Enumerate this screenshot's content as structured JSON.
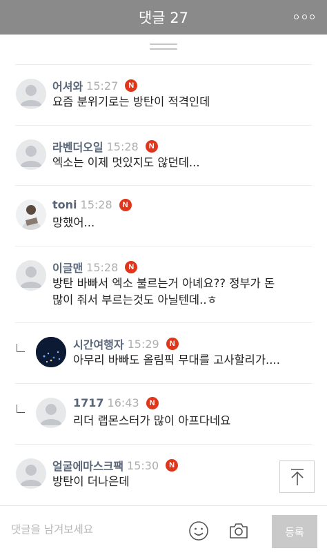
{
  "header": {
    "title": "댓글 27",
    "more_icon": "more-icon"
  },
  "comments": [
    {
      "author": "어셔와",
      "time": "15:27",
      "badge": "N",
      "lines": [
        "요즘 분위기로는 방탄이 적격인데"
      ],
      "avatar": "default"
    },
    {
      "author": "라벤더오일",
      "time": "15:28",
      "badge": "N",
      "lines": [
        "엑소는 이제 멋있지도 않던데..."
      ],
      "avatar": "default"
    },
    {
      "author": "toni",
      "time": "15:28",
      "badge": "N",
      "lines": [
        "망했어..."
      ],
      "avatar": "photo"
    },
    {
      "author": "이글맨",
      "time": "15:28",
      "badge": "N",
      "lines": [
        "방탄 바빠서 엑소 불르는거 아녜요?? 정부가 돈",
        "많이 줘서 부르는것도 아닐텐데..ㅎ"
      ],
      "avatar": "default"
    },
    {
      "author": "시간여행자",
      "time": "15:29",
      "badge": "N",
      "lines": [
        "아무리 바빠도 올림픽 무대를 고사할리가...."
      ],
      "avatar": "city-night",
      "reply": true
    },
    {
      "author": "1717",
      "time": "16:43",
      "badge": "N",
      "lines": [
        "리더 랩몬스터가 많이 아프다네요"
      ],
      "avatar": "default",
      "reply": true
    },
    {
      "author": "얼굴에마스크팩",
      "time": "15:30",
      "badge": "N",
      "lines": [
        "방탄이 더나은데"
      ],
      "avatar": "default"
    }
  ],
  "footer": {
    "placeholder": "댓글을 남겨보세요",
    "emoji_icon": "emoji-icon",
    "camera_icon": "camera-icon",
    "submit_label": "등록"
  },
  "scroll_top_icon": "arrow-up-icon",
  "colors": {
    "header_bg": "#8a8a8a",
    "badge": "#e0361b",
    "author": "#59667a",
    "submit_bg": "#c9c9c9"
  }
}
